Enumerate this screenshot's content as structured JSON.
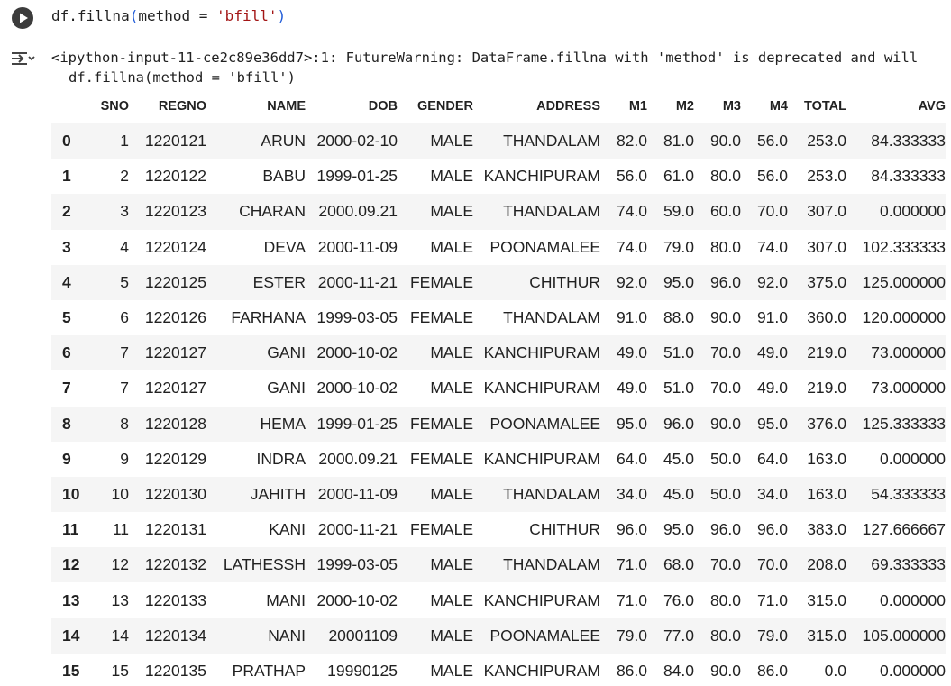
{
  "cell": {
    "code": {
      "prefix": "df.fillna",
      "open_paren": "(",
      "arg": "method = ",
      "value": "'bfill'",
      "close_paren": ")"
    }
  },
  "output": {
    "warning_line1": "<ipython-input-11-ce2c89e36dd7>:1: FutureWarning: DataFrame.fillna with 'method' is deprecated and will",
    "warning_line2": "df.fillna(method = 'bfill')",
    "table": {
      "columns": [
        "",
        "SNO",
        "REGNO",
        "NAME",
        "DOB",
        "GENDER",
        "ADDRESS",
        "M1",
        "M2",
        "M3",
        "M4",
        "TOTAL",
        "AVG"
      ],
      "rows": [
        [
          "0",
          "1",
          "1220121",
          "ARUN",
          "2000-02-10",
          "MALE",
          "THANDALAM",
          "82.0",
          "81.0",
          "90.0",
          "56.0",
          "253.0",
          "84.333333"
        ],
        [
          "1",
          "2",
          "1220122",
          "BABU",
          "1999-01-25",
          "MALE",
          "KANCHIPURAM",
          "56.0",
          "61.0",
          "80.0",
          "56.0",
          "253.0",
          "84.333333"
        ],
        [
          "2",
          "3",
          "1220123",
          "CHARAN",
          "2000.09.21",
          "MALE",
          "THANDALAM",
          "74.0",
          "59.0",
          "60.0",
          "70.0",
          "307.0",
          "0.000000"
        ],
        [
          "3",
          "4",
          "1220124",
          "DEVA",
          "2000-11-09",
          "MALE",
          "POONAMALEE",
          "74.0",
          "79.0",
          "80.0",
          "74.0",
          "307.0",
          "102.333333"
        ],
        [
          "4",
          "5",
          "1220125",
          "ESTER",
          "2000-11-21",
          "FEMALE",
          "CHITHUR",
          "92.0",
          "95.0",
          "96.0",
          "92.0",
          "375.0",
          "125.000000"
        ],
        [
          "5",
          "6",
          "1220126",
          "FARHANA",
          "1999-03-05",
          "FEMALE",
          "THANDALAM",
          "91.0",
          "88.0",
          "90.0",
          "91.0",
          "360.0",
          "120.000000"
        ],
        [
          "6",
          "7",
          "1220127",
          "GANI",
          "2000-10-02",
          "MALE",
          "KANCHIPURAM",
          "49.0",
          "51.0",
          "70.0",
          "49.0",
          "219.0",
          "73.000000"
        ],
        [
          "7",
          "7",
          "1220127",
          "GANI",
          "2000-10-02",
          "MALE",
          "KANCHIPURAM",
          "49.0",
          "51.0",
          "70.0",
          "49.0",
          "219.0",
          "73.000000"
        ],
        [
          "8",
          "8",
          "1220128",
          "HEMA",
          "1999-01-25",
          "FEMALE",
          "POONAMALEE",
          "95.0",
          "96.0",
          "90.0",
          "95.0",
          "376.0",
          "125.333333"
        ],
        [
          "9",
          "9",
          "1220129",
          "INDRA",
          "2000.09.21",
          "FEMALE",
          "KANCHIPURAM",
          "64.0",
          "45.0",
          "50.0",
          "64.0",
          "163.0",
          "0.000000"
        ],
        [
          "10",
          "10",
          "1220130",
          "JAHITH",
          "2000-11-09",
          "MALE",
          "THANDALAM",
          "34.0",
          "45.0",
          "50.0",
          "34.0",
          "163.0",
          "54.333333"
        ],
        [
          "11",
          "11",
          "1220131",
          "KANI",
          "2000-11-21",
          "FEMALE",
          "CHITHUR",
          "96.0",
          "95.0",
          "96.0",
          "96.0",
          "383.0",
          "127.666667"
        ],
        [
          "12",
          "12",
          "1220132",
          "LATHESSH",
          "1999-03-05",
          "MALE",
          "THANDALAM",
          "71.0",
          "68.0",
          "70.0",
          "70.0",
          "208.0",
          "69.333333"
        ],
        [
          "13",
          "13",
          "1220133",
          "MANI",
          "2000-10-02",
          "MALE",
          "KANCHIPURAM",
          "71.0",
          "76.0",
          "80.0",
          "71.0",
          "315.0",
          "0.000000"
        ],
        [
          "14",
          "14",
          "1220134",
          "NANI",
          "20001109",
          "MALE",
          "POONAMALEE",
          "79.0",
          "77.0",
          "80.0",
          "79.0",
          "315.0",
          "105.000000"
        ],
        [
          "15",
          "15",
          "1220135",
          "PRATHAP",
          "19990125",
          "MALE",
          "KANCHIPURAM",
          "86.0",
          "84.0",
          "90.0",
          "86.0",
          "0.0",
          "0.000000"
        ]
      ]
    }
  },
  "icons": {
    "run": "play-circle-icon",
    "output_toggle": "output-collapse-icon"
  },
  "colors": {
    "string_literal": "#a31515",
    "paren": "#1f5bd8",
    "row_stripe": "#f5f5f5"
  }
}
